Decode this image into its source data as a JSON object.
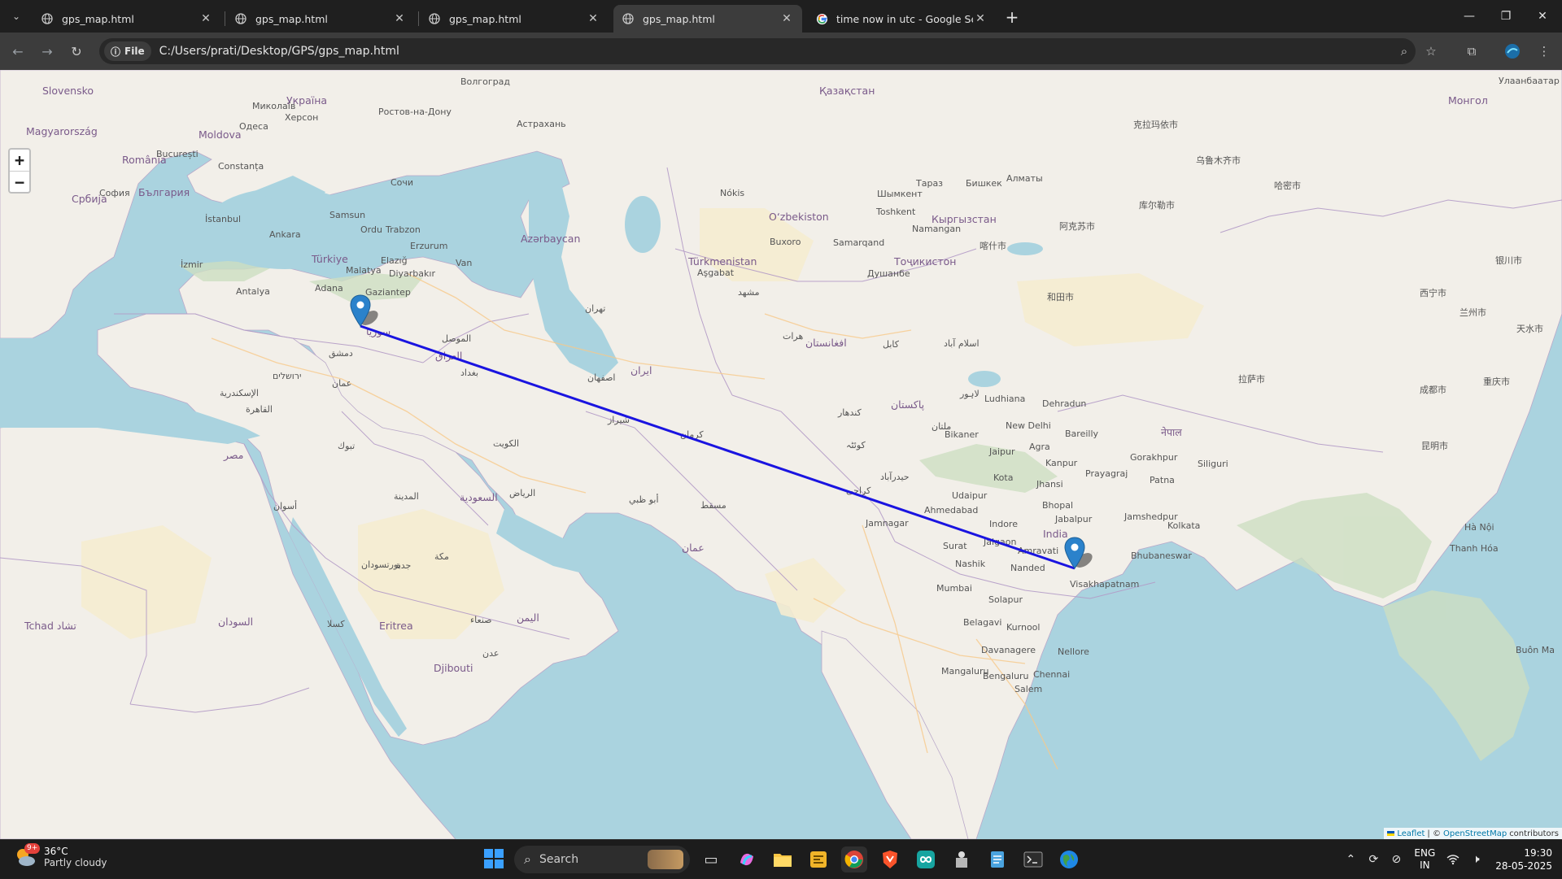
{
  "tabs": [
    {
      "title": "gps_map.html",
      "active": false
    },
    {
      "title": "gps_map.html",
      "active": false
    },
    {
      "title": "gps_map.html",
      "active": false
    },
    {
      "title": "gps_map.html",
      "active": true
    },
    {
      "title": "time now in utc - Google Search",
      "active": false
    }
  ],
  "toolbar": {
    "file_chip": "File",
    "url": "C:/Users/prati/Desktop/GPS/gps_map.html"
  },
  "map": {
    "zoom_in": "+",
    "zoom_out": "−",
    "attribution_leaflet": "Leaflet",
    "attribution_sep": "| ©",
    "attribution_osm": "OpenStreetMap",
    "attribution_tail": "contributors",
    "route_color": "#1a14e0",
    "labels": {
      "slovensko": "Slovensko",
      "ukraina": "Україна",
      "moldova": "Moldova",
      "romania": "România",
      "magyarorszag": "Magyarország",
      "srbija": "Србија",
      "bulgaria": "България",
      "turkiye": "Türkiye",
      "kazakhstan": "Қазақстан",
      "uzbekistan": "Oʻzbekiston",
      "turkmenistan": "Türkmenistan",
      "tojikiston": "Тоҷикистон",
      "kyrgyzstan": "Кыргызстан",
      "azerbaycan": "Azərbaycan",
      "iran": "ایران",
      "iraq": "العراق",
      "syria": "سوريا",
      "pakistan": "پاکستان",
      "afghanistan": "افغانستان",
      "india": "India",
      "oman": "عمان",
      "yemen": "اليمن",
      "saudi": "السعودية",
      "egypt": "مصر",
      "eritrea": "Eritrea",
      "djibouti": "Djibouti",
      "nepal": "नेपाल",
      "mongol": "Монгол",
      "tchad": "Tchad تشاد",
      "sudan": "السودان",
      "astrakhan": "Астрахань",
      "volgograd": "Волгоград",
      "rostov": "Ростов-на-Дону",
      "kherson": "Херсон",
      "odesa": "Одеса",
      "mykolaiv": "Миколаїв",
      "sochi": "Сочи",
      "samsun": "Samsun",
      "istanbul": "İstanbul",
      "ankara": "Ankara",
      "izmir": "İzmir",
      "antalya": "Antalya",
      "adana": "Adana",
      "malatya": "Malatya",
      "elazig": "Elazığ",
      "diyarbakir": "Diyarbakır",
      "gaziantep": "Gaziantep",
      "erzurum": "Erzurum",
      "van": "Van",
      "trabzon": "Trabzon",
      "ordu": "Ordu",
      "bucuresti": "București",
      "constanta": "Constanța",
      "sofia": "София",
      "tehran": "تهران",
      "ashgabat": "Aşgabat",
      "nokis": "Nókis",
      "buxoro": "Buxoro",
      "samarqand": "Samarqand",
      "toshkent": "Toshkent",
      "almaty": "Алматы",
      "bishkek": "Бишкек",
      "dushanbe": "Душанбе",
      "namangan": "Namangan",
      "taraz": "Тараз",
      "shymkent": "Шымкент",
      "kashgar": "喀什市",
      "hotan": "和田市",
      "aksu": "阿克苏市",
      "urumqi": "乌鲁木齐市",
      "karamay": "克拉玛依市",
      "korla": "库尔勒市",
      "hami": "哈密市",
      "ludhiana": "Ludhiana",
      "dehradun": "Dehradun",
      "newdelhi": "New Delhi",
      "agra": "Agra",
      "jaipur": "Jaipur",
      "bikaner": "Bikaner",
      "kanpur": "Kanpur",
      "bareilly": "Bareilly",
      "prayagraj": "Prayagraj",
      "gorakhpur": "Gorakhpur",
      "patna": "Patna",
      "siliguri": "Siliguri",
      "kota": "Kota",
      "jhansi": "Jhansi",
      "bhopal": "Bhopal",
      "jabalpur": "Jabalpur",
      "udaipur": "Udaipur",
      "ahmedabad": "Ahmedabad",
      "surat": "Surat",
      "indore": "Indore",
      "nashik": "Nashik",
      "mumbai": "Mumbai",
      "jalgaon": "Jalgaon",
      "amravati": "Amravati",
      "nanded": "Nanded",
      "solapur": "Solapur",
      "belagavi": "Belagavi",
      "kurnool": "Kurnool",
      "davanagere": "Davanagere",
      "mangaluru": "Mangaluru",
      "bengaluru": "Bengaluru",
      "chennai": "Chennai",
      "nellore": "Nellore",
      "salem": "Salem",
      "visakhapatnam": "Visakhapatnam",
      "bhubaneswar": "Bhubaneswar",
      "kolkata": "Kolkata",
      "jamshedpur": "Jamshedpur",
      "jamnagar": "Jamnagar",
      "karachi": "کراچی",
      "hyderabad_pk": "حیدرآباد",
      "ulaanbaatar": "Улаанбаатар",
      "lanzhou": "兰州市",
      "chengdu": "成都市",
      "kunming": "昆明市",
      "hanoi": "Hà Nội",
      "thanhhoa": "Thanh Hóa",
      "buonma": "Buôn Ma",
      "xining": "西宁市",
      "yinchuan": "银川市",
      "tianshui": "天水市",
      "zhongqing": "重庆市",
      "lhasa": "拉萨市",
      "kuwait": "الكويت",
      "riyadh": "الرياض",
      "jeddah": "جدة",
      "muscat": "مسقط",
      "abudhabi": "أبو ظبي",
      "baghdad": "بغداد",
      "mosul": "الموصل",
      "isfahan": "اصفهان",
      "shiraz": "شیراز",
      "kerman": "کرمان",
      "mashhad": "مشهد",
      "kabul": "کابل",
      "kandahar": "کندهار",
      "herat": "هرات",
      "quetta": "کوئٹہ",
      "multan": "ملتان",
      "lahore": "لاہور",
      "islamabad": "اسلام آباد",
      "damascus": "دمشق",
      "amman": "عمان",
      "jerusalem": "ירושלים",
      "alexandria": "الإسكندرية",
      "cairo": "القاهرة",
      "aswan": "أسوان",
      "tabuk": "تبوك",
      "medina": "المدينة",
      "sanaa": "صنعاء",
      "aden": "عدن",
      "port_sudan": "بورتسودان",
      "kassala": "كسلا",
      "makkah": "مكة"
    }
  },
  "taskbar": {
    "weather_temp": "36°C",
    "weather_cond": "Partly cloudy",
    "weather_badge": "9+",
    "search_label": "Search",
    "lang_top": "ENG",
    "lang_bottom": "IN",
    "time": "19:30",
    "date": "28-05-2025"
  }
}
